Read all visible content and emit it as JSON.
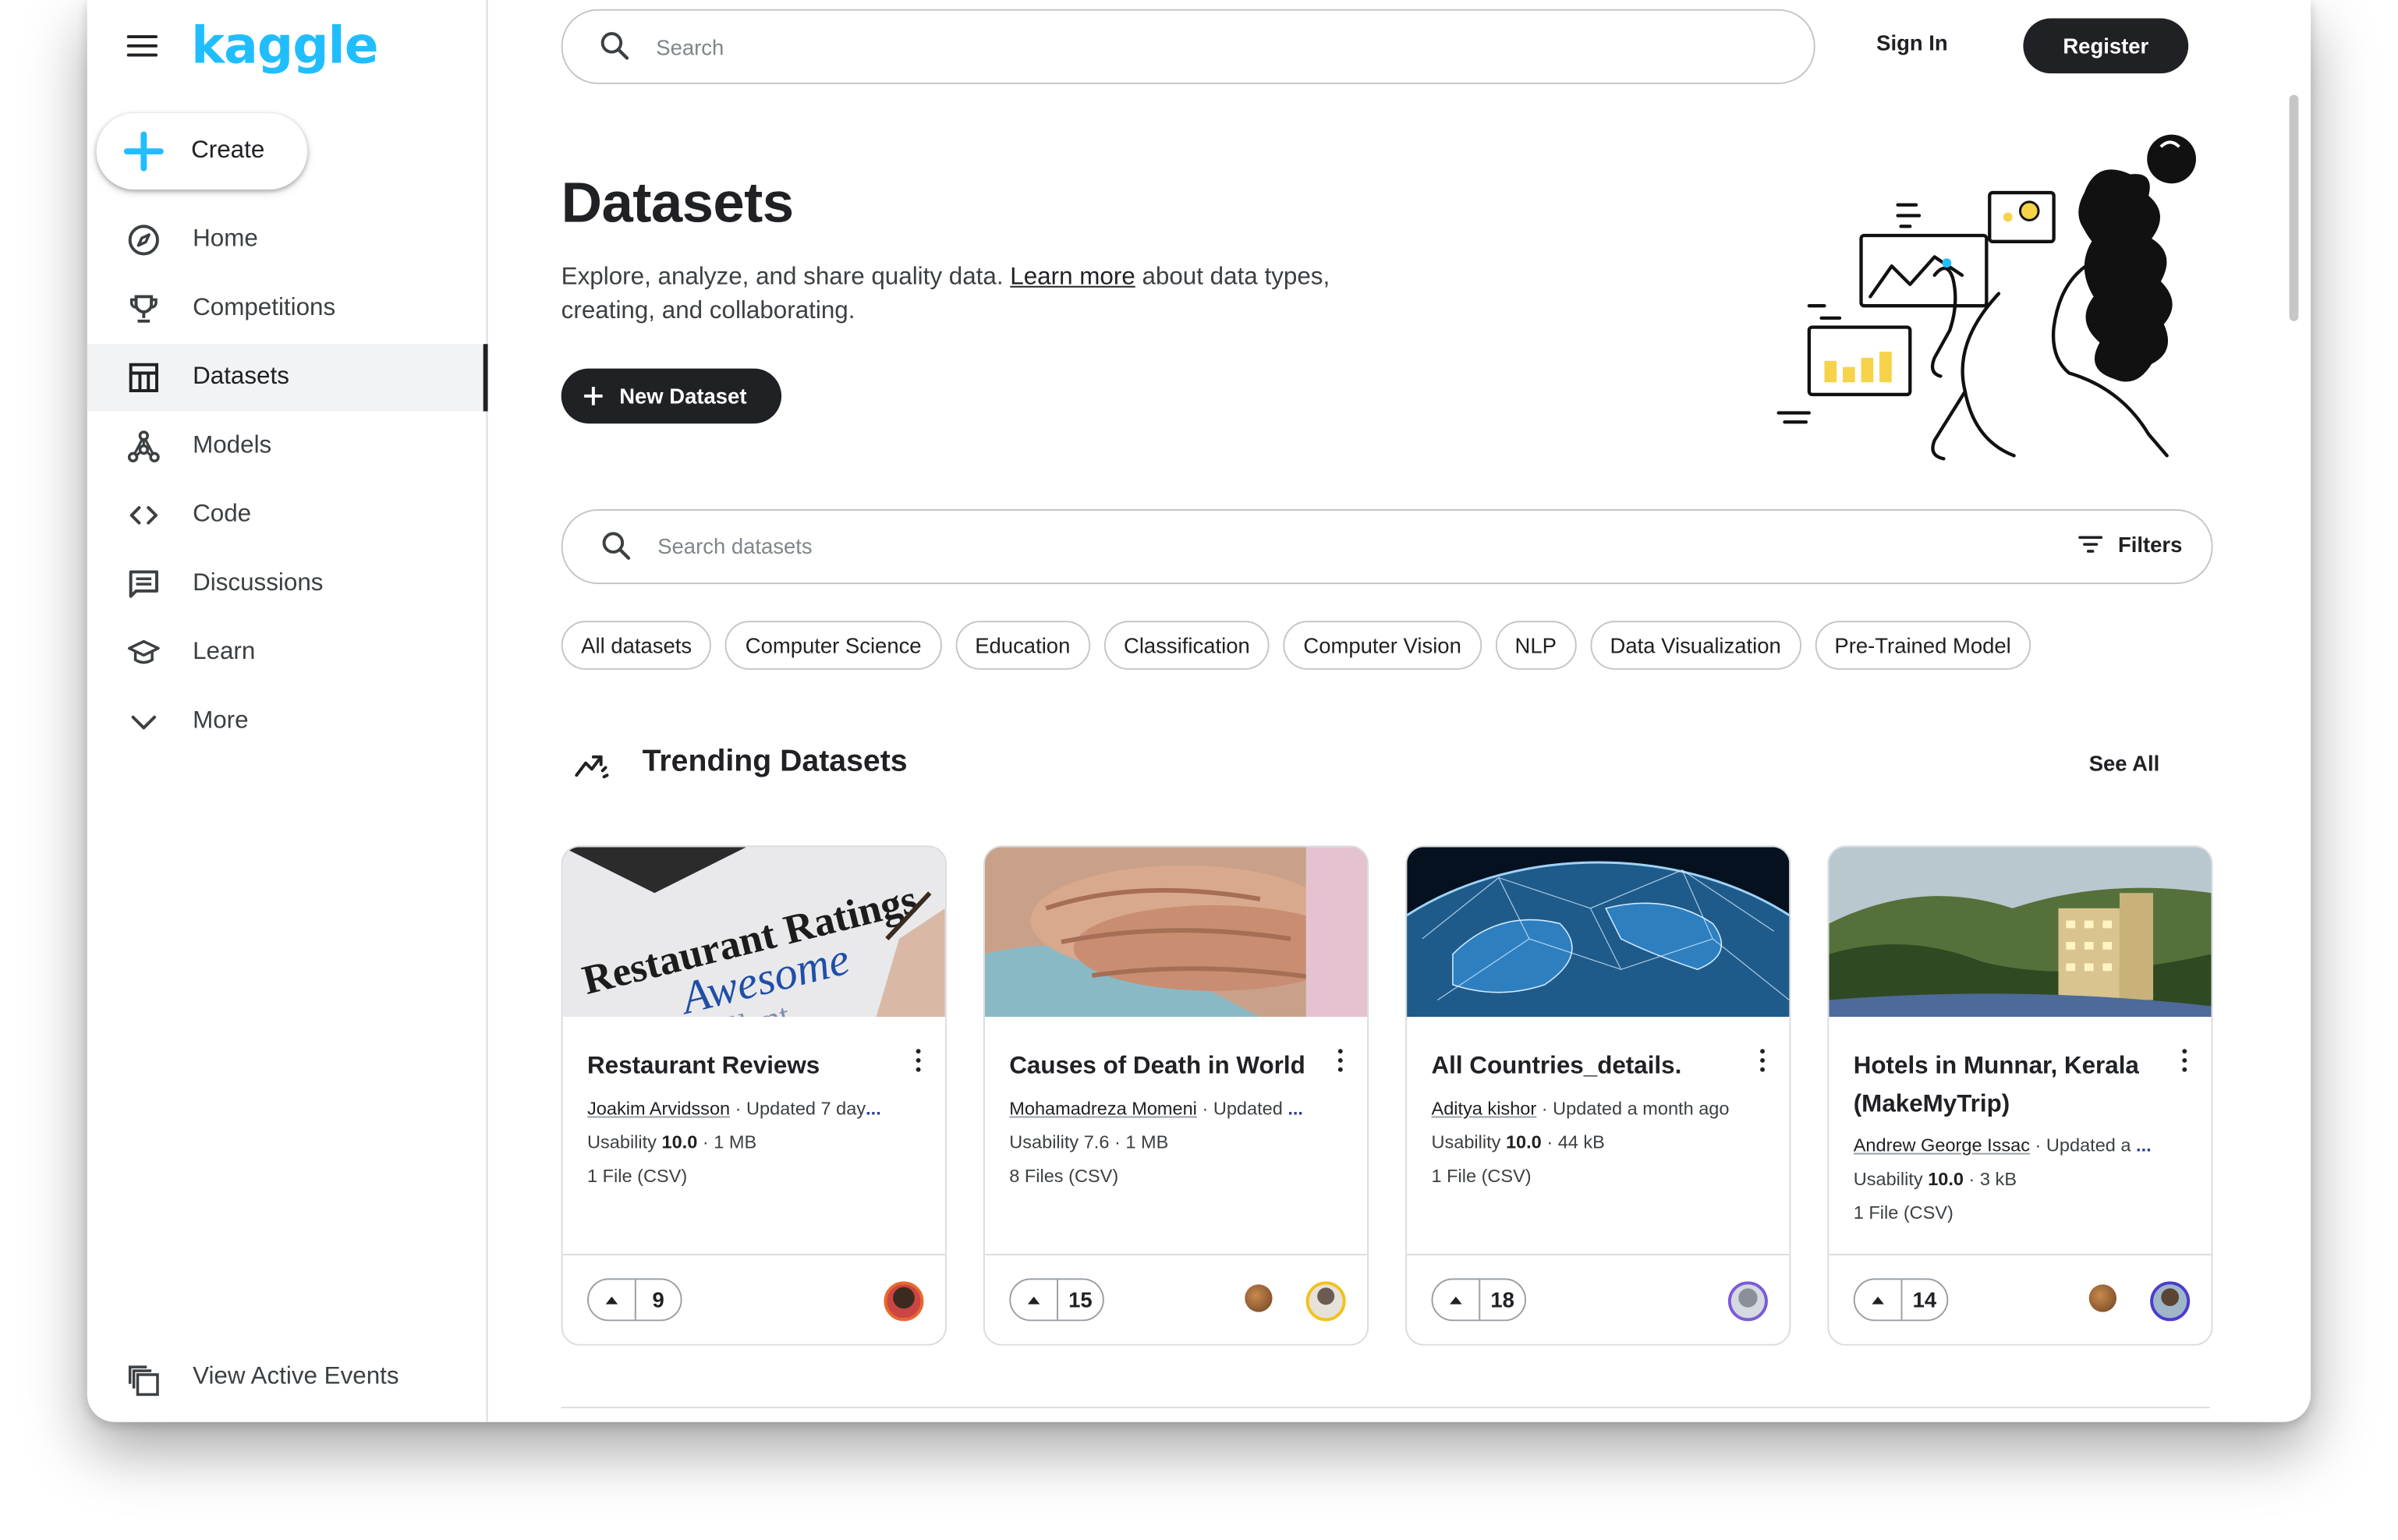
{
  "brand": {
    "logo_text": "kaggle",
    "accent_color": "#20beff"
  },
  "sidebar": {
    "create_label": "Create",
    "items": [
      {
        "label": "Home",
        "icon": "compass-icon"
      },
      {
        "label": "Competitions",
        "icon": "trophy-icon"
      },
      {
        "label": "Datasets",
        "icon": "table-icon",
        "active": true
      },
      {
        "label": "Models",
        "icon": "models-icon"
      },
      {
        "label": "Code",
        "icon": "code-icon"
      },
      {
        "label": "Discussions",
        "icon": "discussions-icon"
      },
      {
        "label": "Learn",
        "icon": "graduation-cap-icon"
      },
      {
        "label": "More",
        "icon": "chevron-down-icon"
      }
    ],
    "view_events_label": "View Active Events"
  },
  "header": {
    "search_placeholder": "Search",
    "sign_in_label": "Sign In",
    "register_label": "Register"
  },
  "hero": {
    "title": "Datasets",
    "desc_before": "Explore, analyze, and share quality data. ",
    "desc_link": "Learn more",
    "desc_after": " about data types, creating, and collaborating.",
    "new_dataset_label": "New Dataset"
  },
  "dataset_search": {
    "placeholder": "Search datasets",
    "filters_label": "Filters"
  },
  "chips": [
    "All datasets",
    "Computer Science",
    "Education",
    "Classification",
    "Computer Vision",
    "NLP",
    "Data Visualization",
    "Pre-Trained Model"
  ],
  "trending": {
    "title": "Trending Datasets",
    "see_all_label": "See All",
    "cards": [
      {
        "title": "Restaurant Reviews",
        "author": "Joakim Arvidsson",
        "updated": " · Updated 7 day",
        "truncated": "...",
        "usability_label": "Usability ",
        "usability": "10.0",
        "size": " · 1 MB",
        "files": "1 File (CSV)",
        "votes": "9",
        "thumb_text_1": "Restaurant Ratings",
        "thumb_text_2": "Awesome",
        "thumb_text_3": "Excellent"
      },
      {
        "title": "Causes of Death in World",
        "author": "Mohamadreza Momeni",
        "updated": " · Updated ",
        "truncated": "...",
        "usability_label": "Usability 7.6",
        "usability": "",
        "size": " · 1 MB",
        "files": "8 Files (CSV)",
        "votes": "15"
      },
      {
        "title": "All Countries_details.",
        "author": "Aditya kishor",
        "updated": " · Updated a month ago",
        "truncated": "",
        "usability_label": "Usability ",
        "usability": "10.0",
        "size": " · 44 kB",
        "files": "1 File (CSV)",
        "votes": "18"
      },
      {
        "title": "Hotels in Munnar, Kerala (MakeMyTrip)",
        "author": "Andrew George Issac",
        "updated": " · Updated a ",
        "truncated": "...",
        "usability_label": "Usability ",
        "usability": "10.0",
        "size": " · 3 kB",
        "files": "1 File (CSV)",
        "votes": "14"
      }
    ]
  }
}
